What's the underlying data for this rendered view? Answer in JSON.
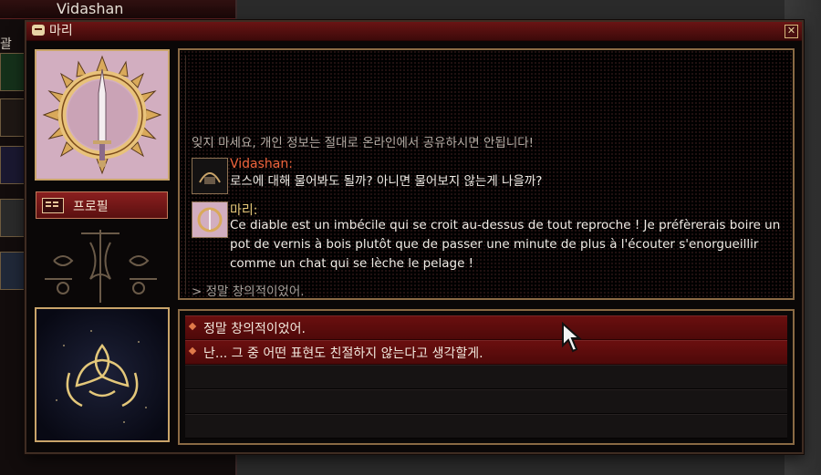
{
  "background_panel": {
    "character_name": "Vidashan",
    "tab_label": "괄"
  },
  "window": {
    "title": "마리",
    "close_symbol": "✕"
  },
  "profile_button": {
    "label": "프로필"
  },
  "chat": {
    "system_notice": "잊지 마세요, 개인 정보는 절대로 온라인에서 공유하시면 안됩니다!",
    "messages": [
      {
        "speaker": "Vidashan:",
        "speaker_color": "#f0643c",
        "text": "로스에 대해 물어봐도 될까? 아니면 물어보지 않는게 나을까?"
      },
      {
        "speaker": "마리:",
        "speaker_color": "#e6c97a",
        "text": "Ce diable est un imbécile qui se croit au-dessus de tout reproche ! Je préfèrerais boire un pot de vernis à bois plutôt que de passer une minute de plus à l'écouter s'enorgueillir comme un chat qui se lèche le pelage !"
      }
    ],
    "previous_reply": "> 정말 창의적이었어."
  },
  "choices": [
    {
      "label": "정말 창의적이었어."
    },
    {
      "label": "난... 그 중 어떤 표현도 친절하지 않는다고 생각할게."
    }
  ],
  "colors": {
    "accent_red": "#6a0f0f",
    "frame_gold": "#c9a46a"
  },
  "icons": {
    "window": "chat-bubble-icon",
    "profile": "id-card-icon"
  }
}
